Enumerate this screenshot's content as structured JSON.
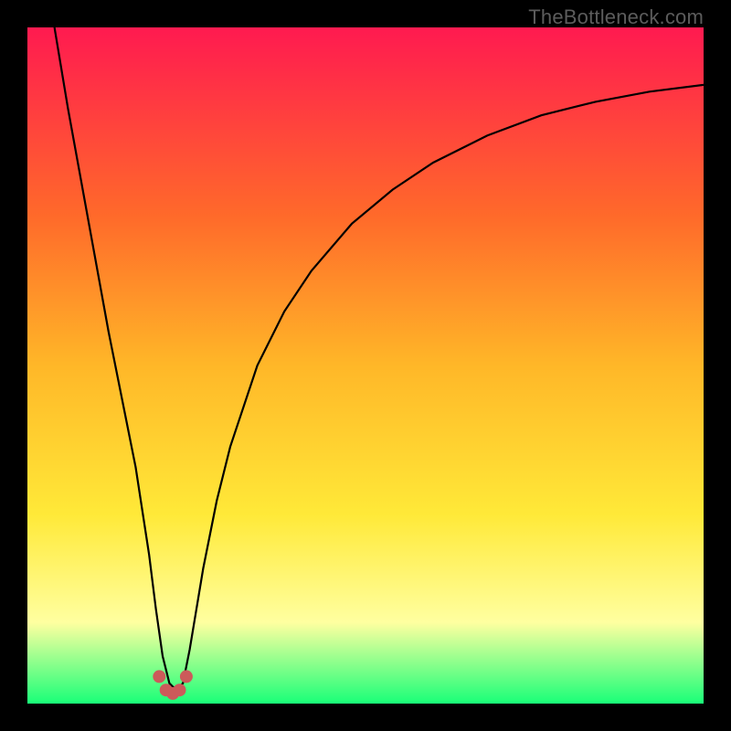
{
  "watermark": "TheBottleneck.com",
  "colors": {
    "black": "#000000",
    "grad_top": "#ff1a50",
    "grad_mid1": "#ff6a2a",
    "grad_mid2": "#ffb728",
    "grad_mid3": "#ffe938",
    "grad_low": "#ffffa0",
    "grad_bottom": "#19ff78",
    "curve": "#000000",
    "marker": "#cc5a5a"
  },
  "chart_data": {
    "type": "line",
    "title": "",
    "xlabel": "",
    "ylabel": "",
    "xlim": [
      0,
      100
    ],
    "ylim": [
      0,
      100
    ],
    "series": [
      {
        "name": "bottleneck-curve",
        "x": [
          4,
          6,
          8,
          10,
          12,
          14,
          16,
          18,
          19,
          20,
          21,
          22,
          23,
          24,
          26,
          28,
          30,
          34,
          38,
          42,
          48,
          54,
          60,
          68,
          76,
          84,
          92,
          100
        ],
        "y": [
          100,
          88,
          77,
          66,
          55,
          45,
          35,
          22,
          14,
          7,
          3,
          2,
          3,
          8,
          20,
          30,
          38,
          50,
          58,
          64,
          71,
          76,
          80,
          84,
          87,
          89,
          90.5,
          91.5
        ]
      }
    ],
    "markers": {
      "name": "minimum-cluster",
      "points": [
        {
          "x": 19.5,
          "y": 4
        },
        {
          "x": 20.5,
          "y": 2
        },
        {
          "x": 21.5,
          "y": 1.5
        },
        {
          "x": 22.5,
          "y": 2
        },
        {
          "x": 23.5,
          "y": 4
        }
      ]
    }
  }
}
